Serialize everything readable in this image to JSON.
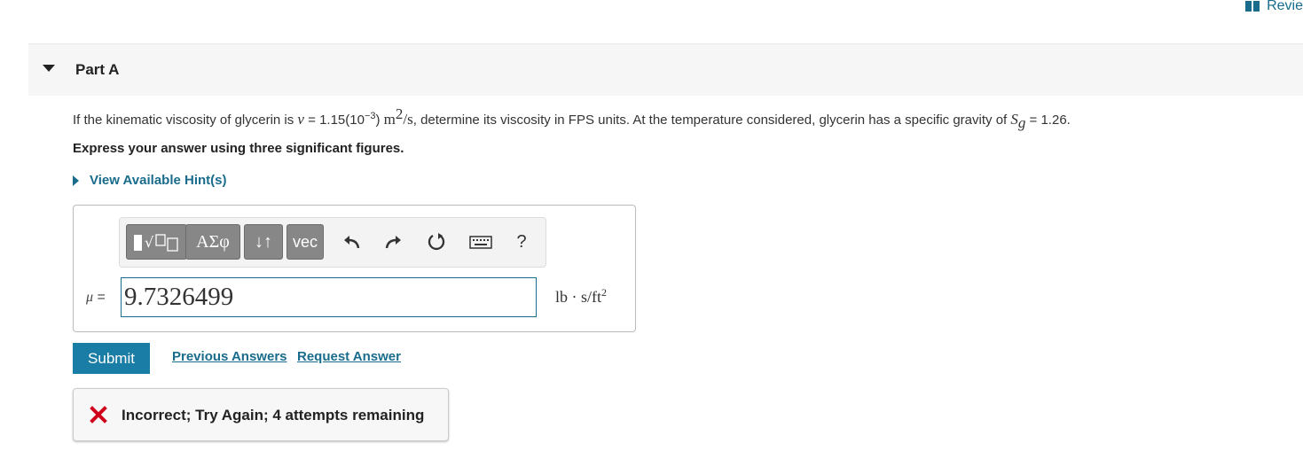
{
  "header": {
    "review_label": "Revie"
  },
  "part": {
    "title": "Part A"
  },
  "question": {
    "text_1": "If the kinematic viscosity of glycerin is ",
    "nu_symbol": "ν",
    "text_2": " = 1.15(10",
    "exponent": "−3",
    "text_3": ") ",
    "unit_m": "m",
    "unit_m_exp": "2",
    "unit_s": "/s",
    "text_4": ", determine its viscosity in FPS units. At the temperature considered, glycerin has a specific gravity of ",
    "sg_symbol": "S",
    "sg_sub": "g",
    "text_5": " = 1.26."
  },
  "instruction": "Express your answer using three significant figures.",
  "hint_label": "View Available Hint(s)",
  "toolbar": {
    "templates_icon": "templates-icon",
    "greek_label": "ΑΣφ",
    "arrows_label": "↓↑",
    "vec_label": "vec",
    "help_label": "?"
  },
  "answer": {
    "variable": "μ",
    "equals": " =",
    "value": "9.7326499",
    "units_main": "lb · s/ft",
    "units_exp": "2"
  },
  "actions": {
    "submit_label": "Submit",
    "previous_answers_label": "Previous Answers",
    "request_answer_label": "Request Answer"
  },
  "feedback": {
    "message": "Incorrect; Try Again; 4 attempts remaining"
  },
  "colors": {
    "accent": "#1a6c8c",
    "submit_bg": "#1a7da5",
    "error": "#d0021b"
  }
}
